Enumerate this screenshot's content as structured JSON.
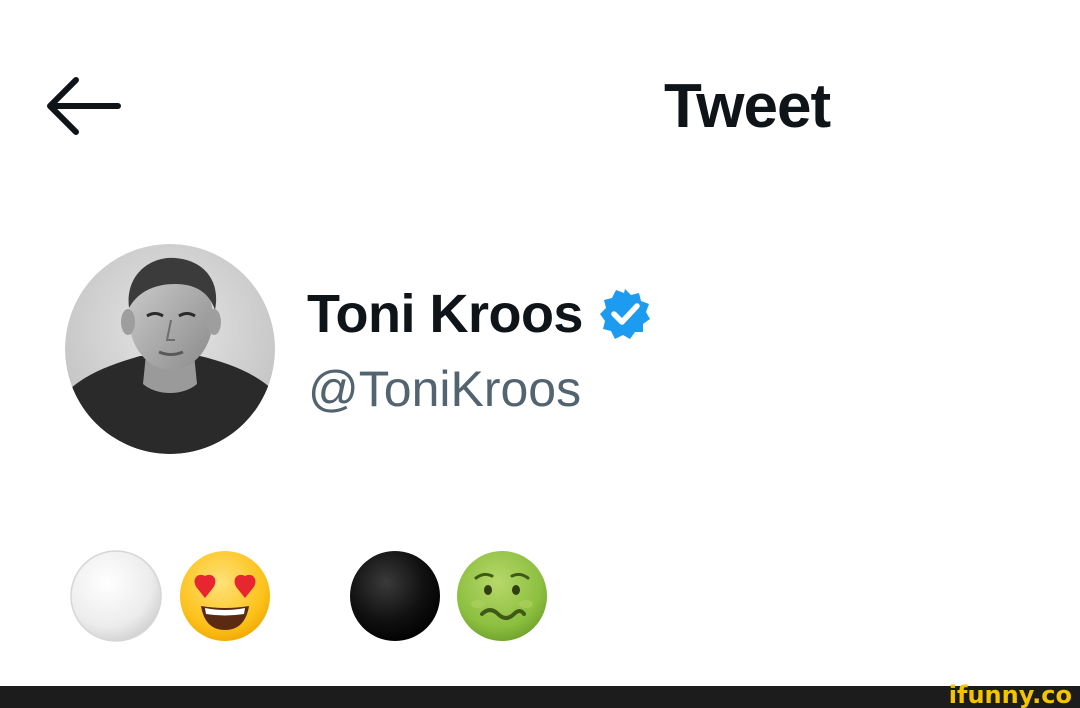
{
  "header": {
    "back_icon": "arrow-left-icon",
    "title": "Tweet"
  },
  "author": {
    "display_name": "Toni Kroos",
    "handle": "@ToniKroos",
    "verified": true,
    "verified_icon": "verified-badge-icon",
    "avatar_icon": "profile-photo"
  },
  "tweet": {
    "emojis": [
      "white-circle-emoji",
      "smiling-face-with-heart-eyes-emoji",
      "black-circle-emoji",
      "nauseated-face-emoji"
    ]
  },
  "watermark": {
    "text": "ifunny.co"
  },
  "colors": {
    "primary_text": "#0f1419",
    "secondary_text": "#536471",
    "verified_blue": "#1d9bf0",
    "footer_bg": "#1c1c1c",
    "watermark": "#f4c400"
  }
}
